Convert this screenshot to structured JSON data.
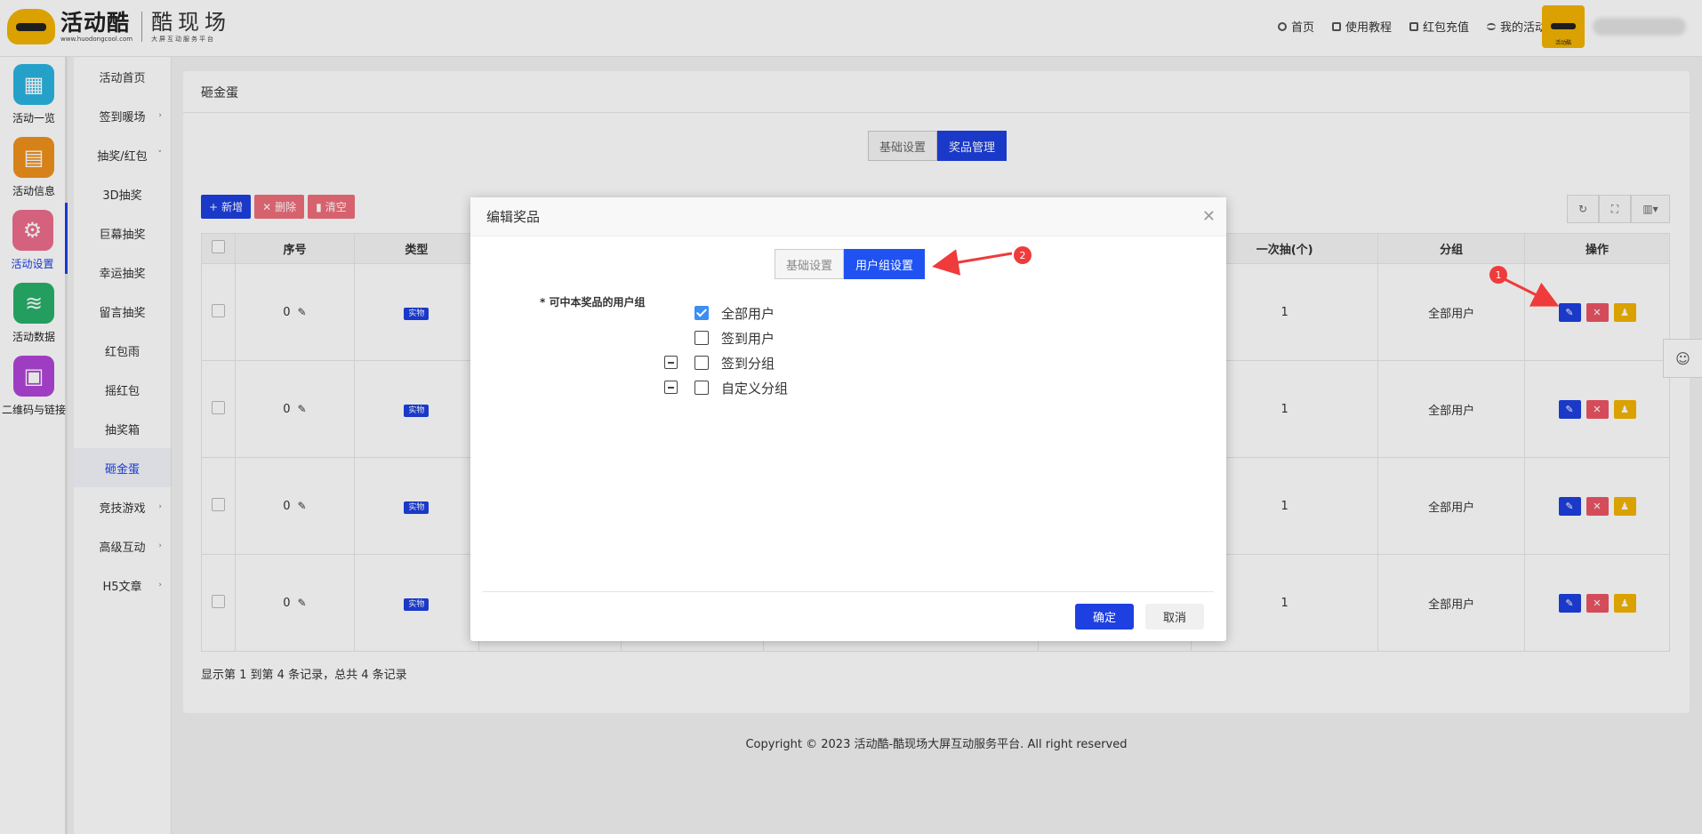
{
  "header": {
    "logo_main": "活动酷",
    "logo_sub": "www.huodongcool.com",
    "logo_right_main": "酷现场",
    "logo_right_sub": "大屏互动服务平台",
    "nav": [
      {
        "label": "首页",
        "icon": "home-icon"
      },
      {
        "label": "使用教程",
        "icon": "book-icon"
      },
      {
        "label": "红包充值",
        "icon": "wallet-icon"
      },
      {
        "label": "我的活动",
        "icon": "list-icon"
      }
    ],
    "avatar_caption": "活动酷"
  },
  "iconbar": [
    {
      "label": "活动一览",
      "color": "#2ab4e0",
      "glyph": "▦"
    },
    {
      "label": "活动信息",
      "color": "#f0901c",
      "glyph": "▤"
    },
    {
      "label": "活动设置",
      "color": "#ec6c8c",
      "glyph": "⚙"
    },
    {
      "label": "活动数据",
      "color": "#27b06a",
      "glyph": "≋"
    },
    {
      "label": "二维码与链接",
      "color": "#b044d8",
      "glyph": "▣"
    }
  ],
  "subnav": [
    {
      "label": "活动首页",
      "arrow": ""
    },
    {
      "label": "签到暖场",
      "arrow": "›"
    },
    {
      "label": "抽奖/红包",
      "arrow": "˅"
    },
    {
      "label": "3D抽奖",
      "arrow": ""
    },
    {
      "label": "巨幕抽奖",
      "arrow": ""
    },
    {
      "label": "幸运抽奖",
      "arrow": ""
    },
    {
      "label": "留言抽奖",
      "arrow": ""
    },
    {
      "label": "红包雨",
      "arrow": ""
    },
    {
      "label": "摇红包",
      "arrow": ""
    },
    {
      "label": "抽奖箱",
      "arrow": ""
    },
    {
      "label": "砸金蛋",
      "arrow": ""
    },
    {
      "label": "竞技游戏",
      "arrow": "›"
    },
    {
      "label": "高级互动",
      "arrow": "›"
    },
    {
      "label": "H5文章",
      "arrow": "›"
    }
  ],
  "panel": {
    "title": "砸金蛋",
    "tabs": [
      "基础设置",
      "奖品管理"
    ],
    "toolbar": {
      "add": "新增",
      "delete": "删除",
      "clear": "清空"
    },
    "columns": {
      "seq": "序号",
      "type": "类型",
      "per_draw": "一次抽(个)",
      "group": "分组",
      "ops": "操作"
    },
    "rows": [
      {
        "seq": "0",
        "type": "实物",
        "per_draw": "1",
        "group": "全部用户"
      },
      {
        "seq": "0",
        "type": "实物",
        "per_draw": "1",
        "group": "全部用户"
      },
      {
        "seq": "0",
        "type": "实物",
        "per_draw": "1",
        "group": "全部用户"
      },
      {
        "seq": "0",
        "type": "实物",
        "per_draw": "1",
        "group": "全部用户"
      }
    ],
    "records": "显示第 1 到第 4 条记录，总共 4 条记录"
  },
  "copyright": "Copyright © 2023 活动酷-酷现场大屏互动服务平台. All right reserved",
  "modal": {
    "title": "编辑奖品",
    "tabs": [
      "基础设置",
      "用户组设置"
    ],
    "label": "* 可中本奖品的用户组",
    "options": [
      {
        "label": "全部用户",
        "checked": true,
        "expandable": false
      },
      {
        "label": "签到用户",
        "checked": false,
        "expandable": false
      },
      {
        "label": "签到分组",
        "checked": false,
        "expandable": true
      },
      {
        "label": "自定义分组",
        "checked": false,
        "expandable": true
      }
    ],
    "ok": "确定",
    "cancel": "取消"
  },
  "annotations": {
    "one": "1",
    "two": "2"
  }
}
